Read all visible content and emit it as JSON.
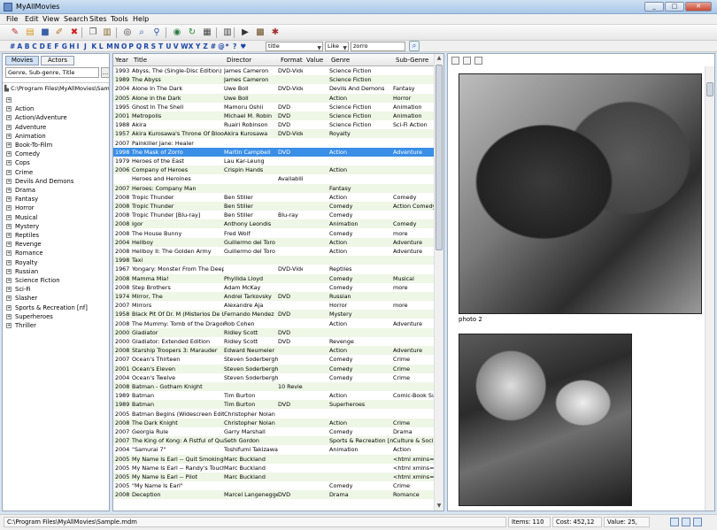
{
  "window": {
    "title": "MyAllMovies",
    "min": "_",
    "max": "□",
    "close": "✕"
  },
  "menu": [
    "File",
    "Edit",
    "View",
    "Search",
    "Sites",
    "Tools",
    "Help"
  ],
  "toolbar_icons": [
    {
      "name": "new-icon",
      "glyph": "✎",
      "color": "#c03030"
    },
    {
      "name": "open-icon",
      "glyph": "▤",
      "color": "#d89a20"
    },
    {
      "name": "save-icon",
      "glyph": "■",
      "color": "#3a5fa8"
    },
    {
      "name": "edit-icon",
      "glyph": "✐",
      "color": "#b07020"
    },
    {
      "name": "delete-icon",
      "glyph": "✖",
      "color": "#d02020"
    },
    {
      "name": "copy-icon",
      "glyph": "❐",
      "color": "#555"
    },
    {
      "name": "paste-icon",
      "glyph": "▥",
      "color": "#8a6a30"
    },
    {
      "name": "binoculars-icon",
      "glyph": "◎",
      "color": "#333"
    },
    {
      "name": "search-icon",
      "glyph": "⌕",
      "color": "#2a5ab0"
    },
    {
      "name": "filter-icon",
      "glyph": "⚲",
      "color": "#2a5ab0"
    },
    {
      "name": "globe-icon",
      "glyph": "◉",
      "color": "#2a7a40"
    },
    {
      "name": "refresh-icon",
      "glyph": "↻",
      "color": "#2a8a2a"
    },
    {
      "name": "layout-icon",
      "glyph": "▦",
      "color": "#444"
    },
    {
      "name": "columns-icon",
      "glyph": "▥",
      "color": "#444"
    },
    {
      "name": "play-icon",
      "glyph": "▶",
      "color": "#333"
    },
    {
      "name": "film-icon",
      "glyph": "▩",
      "color": "#6a4a20"
    },
    {
      "name": "tools-icon",
      "glyph": "✱",
      "color": "#a03030"
    }
  ],
  "alphabet": [
    "#",
    "A",
    "B",
    "C",
    "D",
    "E",
    "F",
    "G",
    "H",
    "I",
    "J",
    "K",
    "L",
    "M",
    "N",
    "O",
    "P",
    "Q",
    "R",
    "S",
    "T",
    "U",
    "V",
    "W",
    "X",
    "Y",
    "Z",
    "#",
    "@",
    "*",
    "?",
    "♥"
  ],
  "filter": {
    "field": "title",
    "operator": "Like",
    "value": "zorro"
  },
  "left_panel": {
    "tabs": [
      "Movies",
      "Actors"
    ],
    "grouping": "Genre, Sub-genre, Title",
    "grouping_button": "...",
    "root_path": "C:\\Program Files\\MyAllMovies\\Sample.mdm",
    "items": [
      "",
      "Action",
      "Action/Adventure",
      "Adventure",
      "Animation",
      "Book-To-Film",
      "Comedy",
      "Cops",
      "Crime",
      "Devils And Demons",
      "Drama",
      "Fantasy",
      "Horror",
      "Musical",
      "Mystery",
      "Reptiles",
      "Revenge",
      "Romance",
      "Royalty",
      "Russian",
      "Science Fiction",
      "Sci-Fi",
      "Slasher",
      "Sports & Recreation [nf]",
      "Superheroes",
      "Thriller"
    ]
  },
  "grid": {
    "columns": [
      "Year",
      "Title",
      "Director",
      "Format",
      "Value",
      "Genre",
      "Sub-Genre"
    ],
    "selected_row": 10,
    "rows": [
      [
        "1993",
        "Abyss, The (Single-Disc Edition)",
        "James Cameron",
        "DVD-Video",
        "",
        "Science Fiction",
        ""
      ],
      [
        "1989",
        "The Abyss",
        "James Cameron",
        "",
        "",
        "Science Fiction",
        ""
      ],
      [
        "2004",
        "Alone In The Dark",
        "Uwe Boll",
        "DVD-Video",
        "",
        "Devils And Demons",
        "Fantasy"
      ],
      [
        "2005",
        "Alone in the Dark",
        "Uwe Boll",
        "",
        "",
        "Action",
        "Horror"
      ],
      [
        "1995",
        "Ghost In The Shell",
        "Mamoru Oshii",
        "DVD",
        "",
        "Science Fiction",
        "Animation"
      ],
      [
        "2001",
        "Metropolis",
        "Michael M. Robin",
        "DVD",
        "",
        "Science Fiction",
        "Animation"
      ],
      [
        "1988",
        "Akira",
        "Ruairi Robinson",
        "DVD",
        "",
        "Science Fiction",
        "Sci-Fi Action"
      ],
      [
        "1957",
        "Akira Kurosawa's Throne Of Blood",
        "Akira Kurosawa",
        "DVD-Video",
        "",
        "Royalty",
        ""
      ],
      [
        "2007",
        "Painkiller Jane: Healer",
        "",
        "",
        "",
        "",
        ""
      ],
      [
        "1998",
        "The Mask of Zorro",
        "Martin Campbell",
        "DVD",
        "",
        "Action",
        "Adventure"
      ],
      [
        "1979",
        "Heroes of the East",
        "Lau Kar-Leung",
        "",
        "",
        "",
        ""
      ],
      [
        "2006",
        "Company of Heroes",
        "Crispin Hands",
        "",
        "",
        "Action",
        ""
      ],
      [
        "",
        "Heroes and Heroines",
        "",
        "Availability",
        "",
        "",
        ""
      ],
      [
        "2007",
        "Heroes: Company Man",
        "",
        "",
        "",
        "Fantasy",
        ""
      ],
      [
        "2008",
        "Tropic Thunder",
        "Ben Stiller",
        "",
        "",
        "Action",
        "Comedy"
      ],
      [
        "2008",
        "Tropic Thunder",
        "Ben Stiller",
        "",
        "",
        "Comedy",
        "Action Comedy"
      ],
      [
        "2008",
        "Tropic Thunder [Blu-ray]",
        "Ben Stiller",
        "Blu-ray",
        "",
        "Comedy",
        ""
      ],
      [
        "2008",
        "Igor",
        "Anthony Leondis",
        "",
        "",
        "Animation",
        "Comedy"
      ],
      [
        "2008",
        "The House Bunny",
        "Fred Wolf",
        "",
        "",
        "Comedy",
        "more"
      ],
      [
        "2004",
        "Hellboy",
        "Guillermo del Toro",
        "",
        "",
        "Action",
        "Adventure"
      ],
      [
        "2008",
        "Hellboy II: The Golden Army",
        "Guillermo del Toro",
        "",
        "",
        "Action",
        "Adventure"
      ],
      [
        "1998",
        "Taxi",
        "",
        "",
        "",
        "",
        ""
      ],
      [
        "1967",
        "Yongary: Monster From The Deep",
        "",
        "DVD-Video",
        "",
        "Reptiles",
        ""
      ],
      [
        "2008",
        "Mamma Mia!",
        "Phyllida Lloyd",
        "",
        "",
        "Comedy",
        "Musical"
      ],
      [
        "2008",
        "Step Brothers",
        "Adam McKay",
        "",
        "",
        "Comedy",
        "more"
      ],
      [
        "1974",
        "Mirror, The",
        "Andrei Tarkovsky",
        "DVD",
        "",
        "Russian",
        ""
      ],
      [
        "2007",
        "Mirrors",
        "Alexandre Aja",
        "",
        "",
        "Horror",
        "more"
      ],
      [
        "1958",
        "Black Pit Of Dr. M (Misterios De Ultratumba)",
        "Fernando Mendez",
        "DVD",
        "",
        "Mystery",
        ""
      ],
      [
        "2008",
        "The Mummy: Tomb of the Dragon Emperor",
        "Rob Cohen",
        "",
        "",
        "Action",
        "Adventure"
      ],
      [
        "2000",
        "Gladiator",
        "Ridley Scott",
        "DVD",
        "",
        "",
        ""
      ],
      [
        "2000",
        "Gladiator: Extended Edition",
        "Ridley Scott",
        "DVD",
        "",
        "Revenge",
        ""
      ],
      [
        "2008",
        "Starship Troopers 3: Marauder",
        "Edward Neumeier",
        "",
        "",
        "Action",
        "Adventure"
      ],
      [
        "2007",
        "Ocean's Thirteen",
        "Steven Soderbergh",
        "",
        "",
        "Comedy",
        "Crime"
      ],
      [
        "2001",
        "Ocean's Eleven",
        "Steven Soderbergh",
        "",
        "",
        "Comedy",
        "Crime"
      ],
      [
        "2004",
        "Ocean's Twelve",
        "Steven Soderbergh",
        "",
        "",
        "Comedy",
        "Crime"
      ],
      [
        "2008",
        "Batman - Gotham Knight",
        "",
        "10 Reviews",
        "",
        "",
        ""
      ],
      [
        "1989",
        "Batman",
        "Tim Burton",
        "",
        "",
        "Action",
        "Comic-Book Superhero"
      ],
      [
        "1989",
        "Batman",
        "Tim Burton",
        "DVD",
        "",
        "Superheroes",
        ""
      ],
      [
        "2005",
        "Batman Begins (Widescreen Edition)",
        "Christopher Nolan",
        "",
        "",
        "",
        ""
      ],
      [
        "2008",
        "The Dark Knight",
        "Christopher Nolan",
        "",
        "",
        "Action",
        "Crime"
      ],
      [
        "2007",
        "Georgia Rule",
        "Garry Marshall",
        "",
        "",
        "Comedy",
        "Drama"
      ],
      [
        "2007",
        "The King of Kong: A Fistful of Quarters",
        "Seth Gordon",
        "",
        "",
        "Sports & Recreation [nf]",
        "Culture & Society"
      ],
      [
        "2004",
        "\"Samurai 7\"",
        "Toshifumi Takizawa",
        "",
        "",
        "Animation",
        "Action"
      ],
      [
        "2005",
        "My Name Is Earl -- Quit Smoking",
        "Marc Buckland",
        "",
        "",
        "",
        "<html xmlns=\"http"
      ],
      [
        "2005",
        "My Name Is Earl -- Randy's Touchdown",
        "Marc Buckland",
        "",
        "",
        "",
        "<html xmlns=\"http"
      ],
      [
        "2005",
        "My Name Is Earl -- Pilot",
        "Marc Buckland",
        "",
        "",
        "",
        "<html xmlns=\"http"
      ],
      [
        "2005",
        "\"My Name Is Earl\"",
        "",
        "",
        "",
        "Comedy",
        "Crime"
      ],
      [
        "2008",
        "Deception",
        "Marcel Langenegger",
        "DVD",
        "",
        "Drama",
        "Romance"
      ]
    ]
  },
  "preview": {
    "caption": "photo 2"
  },
  "status": {
    "path": "C:\\Program Files\\MyAllMovies\\Sample.mdm",
    "items": "Items: 110",
    "cost": "Cost: 452,12",
    "value": "Value: 25,"
  }
}
